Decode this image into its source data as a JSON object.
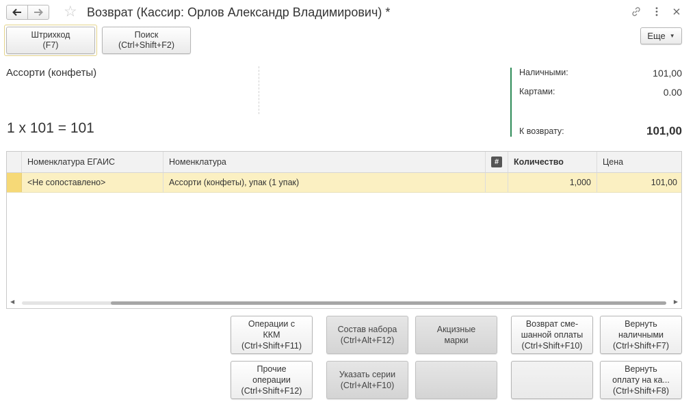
{
  "window": {
    "title": "Возврат (Кассир: Орлов Александр Владимирович) *"
  },
  "toolbar": {
    "barcode_label": "Штрихкод",
    "barcode_hotkey": "(F7)",
    "search_label": "Поиск",
    "search_hotkey": "(Ctrl+Shift+F2)",
    "more_label": "Еще"
  },
  "info": {
    "product_name": "Ассорти (конфеты)",
    "calculation": "1 x 101 = 101"
  },
  "payment": {
    "cash_label": "Наличными:",
    "cash_value": "101,00",
    "cards_label": "Картами:",
    "cards_value": "0.00",
    "refund_label": "К возврату:",
    "refund_value": "101,00",
    "accent_color": "#2e8b57"
  },
  "table": {
    "columns": [
      "Номенклатура ЕГАИС",
      "Номенклатура",
      "#",
      "Количество",
      "Цена"
    ],
    "rows": [
      {
        "egais": "<Не сопоставлено>",
        "nomenclature": "Ассорти (конфеты), упак (1 упак)",
        "hash": "",
        "quantity": "1,000",
        "price": "101,00"
      }
    ],
    "selected_row_color": "#fbf0c2"
  },
  "actions": {
    "kkm_line1": "Операции с",
    "kkm_line2": "ККМ",
    "kkm_line3": "(Ctrl+Shift+F11)",
    "set_line1": "Состав набора",
    "set_line2": "(Ctrl+Alt+F12)",
    "excise_line1": "Акцизные",
    "excise_line2": "марки",
    "mixed_line1": "Возврат сме-",
    "mixed_line2": "шанной оплаты",
    "mixed_line3": "(Ctrl+Shift+F10)",
    "cash_line1": "Вернуть",
    "cash_line2": "наличными",
    "cash_line3": "(Ctrl+Shift+F7)",
    "other_line1": "Прочие",
    "other_line2": "операции",
    "other_line3": "(Ctrl+Shift+F12)",
    "series_line1": "Указать серии",
    "series_line2": "(Ctrl+Alt+F10)",
    "card_line1": "Вернуть",
    "card_line2": "оплату на ка...",
    "card_line3": "(Ctrl+Shift+F8)"
  },
  "icons": {
    "back": "arrow-left-icon",
    "forward": "arrow-right-icon",
    "favorite": "star-icon",
    "link": "link-icon",
    "menu": "more-vertical-icon",
    "close": "close-icon",
    "dropdown": "caret-down-icon",
    "column_hash": "hash-icon"
  }
}
